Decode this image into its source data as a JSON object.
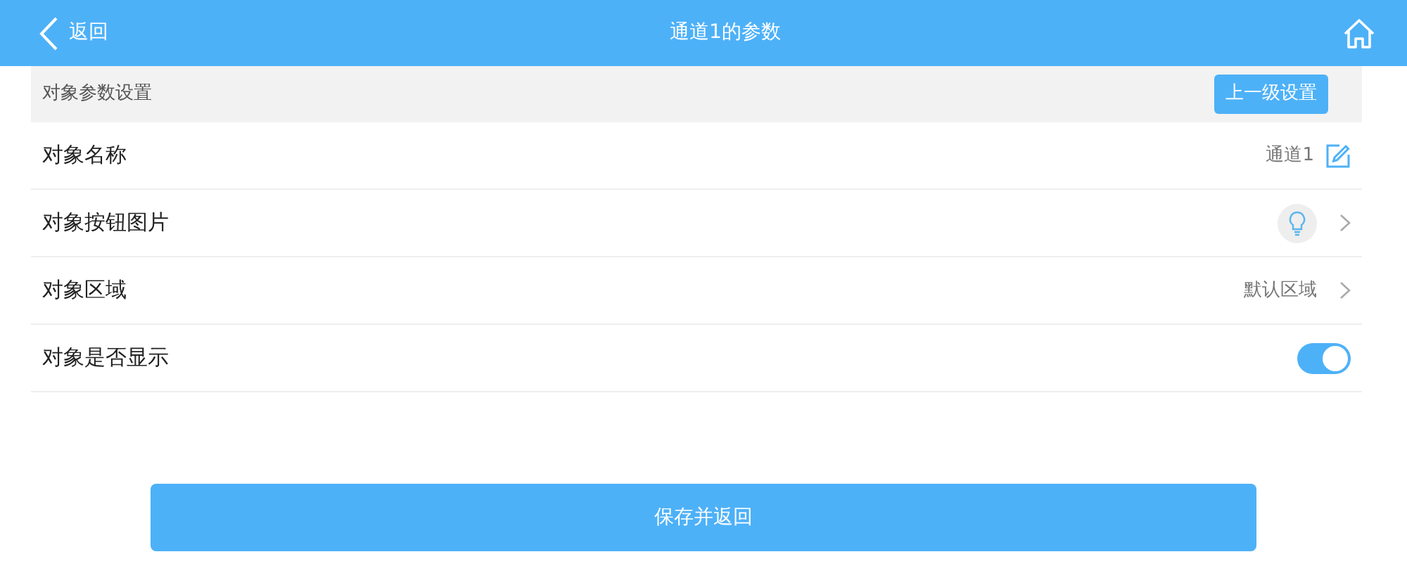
{
  "header": {
    "back": "返回",
    "title": "通道1的参数"
  },
  "section": {
    "title": "对象参数设置",
    "action": "上一级设置"
  },
  "rows": [
    {
      "kind": "edit",
      "label": "对象名称",
      "value": "通道1"
    },
    {
      "kind": "image",
      "label": "对象按钮图片"
    },
    {
      "kind": "link",
      "label": "对象区域",
      "value": "默认区域"
    },
    {
      "kind": "toggle",
      "label": "对象是否显示",
      "on": true
    }
  ],
  "save_button": "保存并返回"
}
